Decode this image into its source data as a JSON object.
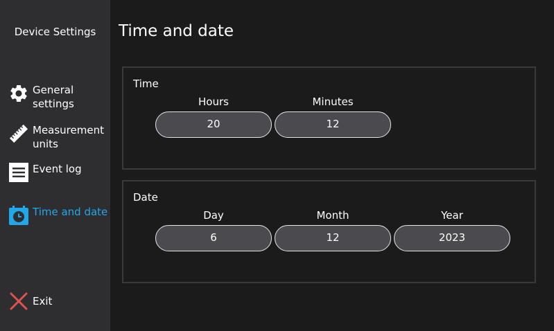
{
  "sidebar": {
    "app_title": "Device Settings",
    "items": [
      {
        "label": "General settings",
        "icon": "gear-icon",
        "active": false
      },
      {
        "label": "Measurement units",
        "icon": "ruler-icon",
        "active": false
      },
      {
        "label": "Event log",
        "icon": "list-icon",
        "active": false
      },
      {
        "label": "Time and date",
        "icon": "calendar-clock-icon",
        "active": true
      }
    ],
    "exit": {
      "label": "Exit",
      "icon": "close-icon"
    }
  },
  "main": {
    "title": "Time and date",
    "time_panel": {
      "title": "Time",
      "hours": {
        "label": "Hours",
        "value": "20"
      },
      "minutes": {
        "label": "Minutes",
        "value": "12"
      }
    },
    "date_panel": {
      "title": "Date",
      "day": {
        "label": "Day",
        "value": "6"
      },
      "month": {
        "label": "Month",
        "value": "12"
      },
      "year": {
        "label": "Year",
        "value": "2023"
      }
    }
  },
  "colors": {
    "accent": "#22a7ea",
    "exit_red": "#e05252",
    "sidebar_bg": "#2e2e31",
    "main_bg": "#1b1b1b",
    "pill_bg": "#4a4a4f"
  }
}
